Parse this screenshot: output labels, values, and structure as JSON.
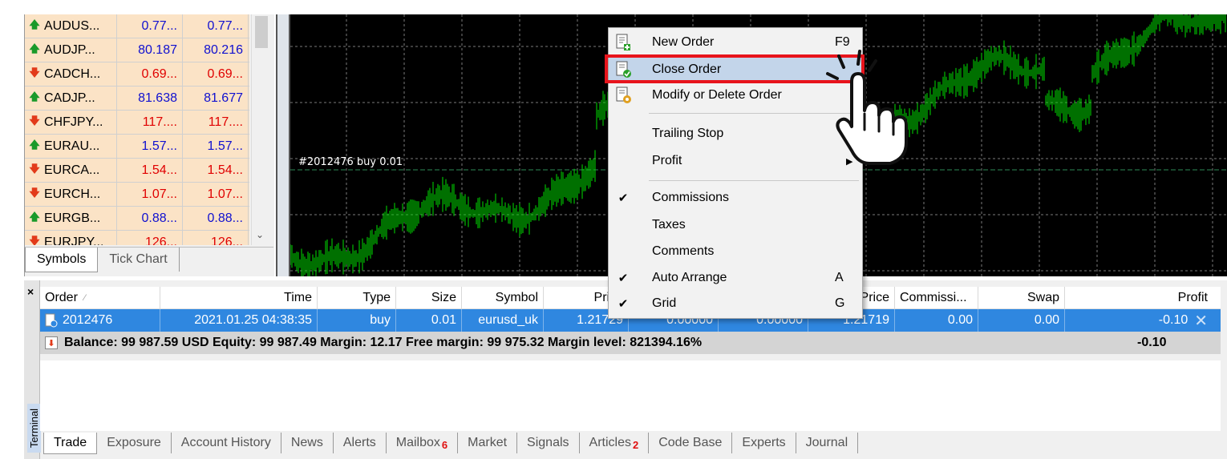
{
  "market_watch": {
    "rows": [
      {
        "symbol": "AUDUS...",
        "bid": "0.77...",
        "ask": "0.77...",
        "dir": "up"
      },
      {
        "symbol": "AUDJP...",
        "bid": "80.187",
        "ask": "80.216",
        "dir": "up"
      },
      {
        "symbol": "CADCH...",
        "bid": "0.69...",
        "ask": "0.69...",
        "dir": "down"
      },
      {
        "symbol": "CADJP...",
        "bid": "81.638",
        "ask": "81.677",
        "dir": "up"
      },
      {
        "symbol": "CHFJPY...",
        "bid": "117....",
        "ask": "117....",
        "dir": "down"
      },
      {
        "symbol": "EURAU...",
        "bid": "1.57...",
        "ask": "1.57...",
        "dir": "up"
      },
      {
        "symbol": "EURCA...",
        "bid": "1.54...",
        "ask": "1.54...",
        "dir": "down"
      },
      {
        "symbol": "EURCH...",
        "bid": "1.07...",
        "ask": "1.07...",
        "dir": "down"
      },
      {
        "symbol": "EURGB...",
        "bid": "0.88...",
        "ask": "0.88...",
        "dir": "up"
      },
      {
        "symbol": "EURJPY...",
        "bid": "126...",
        "ask": "126...",
        "dir": "down"
      }
    ],
    "tabs": [
      "Symbols",
      "Tick Chart"
    ]
  },
  "chart": {
    "order_line_label": "#2012476 buy 0.01",
    "background": "#000000",
    "bar_color": "#00e000"
  },
  "context_menu": {
    "items": [
      {
        "label": "New Order",
        "key": "F9",
        "icon": "new-order-icon"
      },
      {
        "label": "Close Order",
        "key": "",
        "icon": "close-order-icon"
      },
      {
        "label": "Modify or Delete Order",
        "key": "",
        "icon": "modify-order-icon"
      },
      {
        "label": "Trailing Stop",
        "key": ""
      },
      {
        "label": "Profit",
        "key": ""
      },
      {
        "label": "Commissions",
        "key": "",
        "checked": true
      },
      {
        "label": "Taxes",
        "key": ""
      },
      {
        "label": "Comments",
        "key": ""
      },
      {
        "label": "Auto Arrange",
        "key": "A",
        "checked": true
      },
      {
        "label": "Grid",
        "key": "G",
        "checked": true
      }
    ],
    "highlight_color": "#e8141c"
  },
  "terminal": {
    "side_label": "Terminal",
    "columns": [
      "Order",
      "Time",
      "Type",
      "Size",
      "Symbol",
      "Price",
      "",
      "",
      "Price",
      "Commissi...",
      "Swap",
      "Profit"
    ],
    "order_row": {
      "order": "2012476",
      "time": "2021.01.25 04:38:35",
      "type": "buy",
      "size": "0.01",
      "symbol": "eurusd_uk",
      "price": "1.21729",
      "sl": "0.00000",
      "tp": "0.00000",
      "cur_price": "1.21719",
      "commission": "0.00",
      "swap": "0.00",
      "profit": "-0.10"
    },
    "balance_text": "Balance: 99 987.59 USD  Equity: 99 987.49  Margin: 12.17  Free margin: 99 975.32  Margin level: 821394.16%",
    "balance_profit": "-0.10",
    "tabs": [
      {
        "label": "Trade"
      },
      {
        "label": "Exposure"
      },
      {
        "label": "Account History"
      },
      {
        "label": "News"
      },
      {
        "label": "Alerts"
      },
      {
        "label": "Mailbox",
        "badge": "6"
      },
      {
        "label": "Market"
      },
      {
        "label": "Signals"
      },
      {
        "label": "Articles",
        "badge": "2"
      },
      {
        "label": "Code Base"
      },
      {
        "label": "Experts"
      },
      {
        "label": "Journal"
      }
    ]
  }
}
